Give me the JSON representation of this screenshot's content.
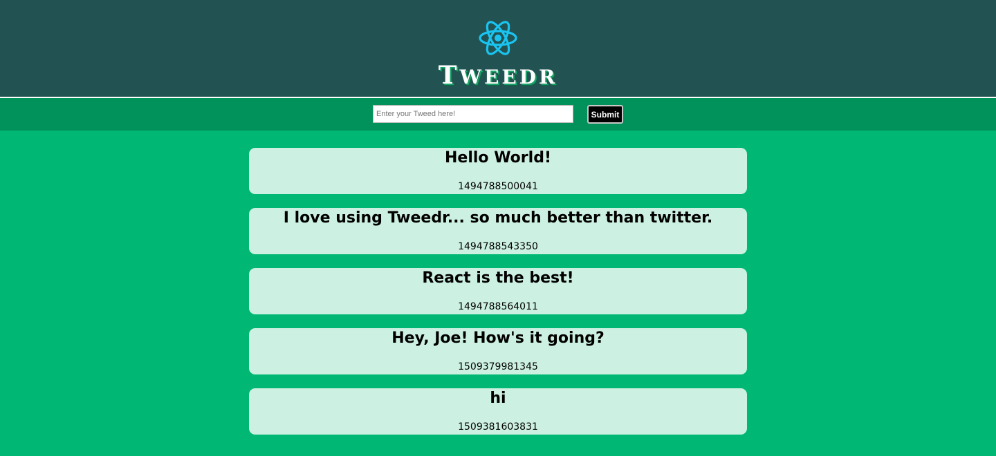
{
  "header": {
    "logo_icon": "react-atom-icon",
    "title_first": "T",
    "title_rest": "WEEDR",
    "background": "#235252"
  },
  "toolbar": {
    "input_placeholder": "Enter your Tweed here!",
    "input_value": "",
    "submit_label": "Submit"
  },
  "tweeds": [
    {
      "text": "Hello World!",
      "timestamp": "1494788500041"
    },
    {
      "text": "I love using Tweedr... so much better than twitter.",
      "timestamp": "1494788543350"
    },
    {
      "text": "React is the best!",
      "timestamp": "1494788564011"
    },
    {
      "text": "Hey, Joe! How's it going?",
      "timestamp": "1509379981345"
    },
    {
      "text": "hi",
      "timestamp": "1509381603831"
    }
  ],
  "colors": {
    "page_background": "#00b873",
    "toolbar_background": "#00925a",
    "card_background": "#ccf0e1",
    "logo_accent": "#19c5f0"
  }
}
